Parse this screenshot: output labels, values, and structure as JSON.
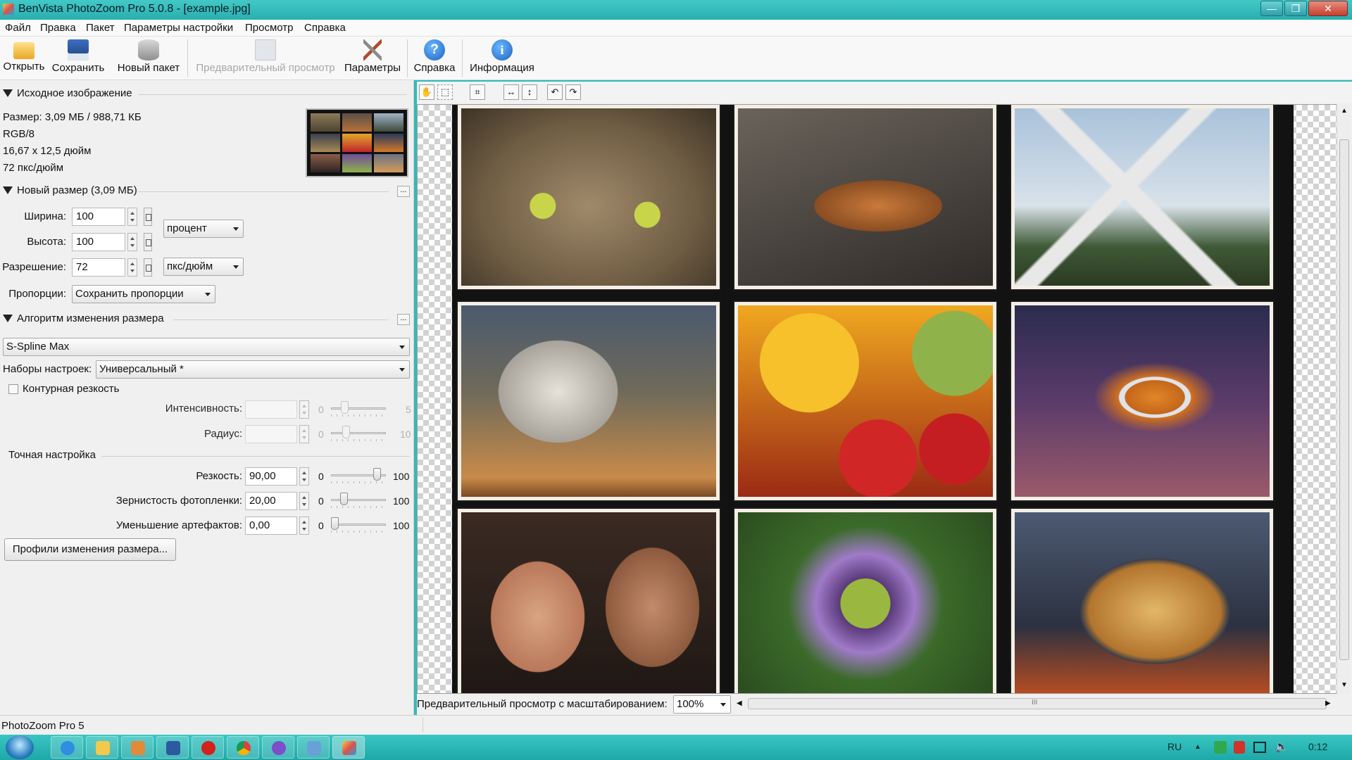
{
  "window": {
    "title": "BenVista PhotoZoom Pro 5.0.8 - [example.jpg]",
    "controls": [
      "—",
      "❐",
      "✕"
    ]
  },
  "menu": [
    "Файл",
    "Правка",
    "Пакет",
    "Параметры настройки",
    "Просмотр",
    "Справка"
  ],
  "toolbar": {
    "open": "Открыть",
    "save": "Сохранить",
    "new_batch": "Новый пакет",
    "preview": "Предварительный просмотр",
    "settings": "Параметры",
    "help": "Справка",
    "info": "Информация"
  },
  "source": {
    "header": "Исходное изображение",
    "size": "Размер: 3,09 МБ / 988,71 КБ",
    "mode": "RGB/8",
    "dimensions": "16,67 x 12,5 дюйм",
    "resolution": "72 пкс/дюйм"
  },
  "new_size": {
    "header": "Новый размер (3,09 МБ)",
    "more_button": "...",
    "width_label": "Ширина:",
    "width_value": "100",
    "height_label": "Высота:",
    "height_value": "100",
    "size_unit": "процент",
    "resolution_label": "Разрешение:",
    "resolution_value": "72",
    "resolution_unit": "пкс/дюйм",
    "proportions_label": "Пропорции:",
    "proportions_value": "Сохранить пропорции"
  },
  "algorithm": {
    "header": "Алгоритм изменения размера",
    "more_button": "...",
    "method": "S-Spline Max",
    "presets_label": "Наборы настроек:",
    "presets_value": "Универсальный *",
    "unsharp_label": "Контурная резкость",
    "intensity_label": "Интенсивность:",
    "intensity_min": "0",
    "intensity_max": "5",
    "radius_label": "Радиус:",
    "radius_min": "0",
    "radius_max": "10",
    "fine_header": "Точная настройка",
    "sharpness_label": "Резкость:",
    "sharpness_value": "90,00",
    "sharpness_min": "0",
    "sharpness_max": "100",
    "grain_label": "Зернистость фотопленки:",
    "grain_value": "20,00",
    "grain_min": "0",
    "grain_max": "100",
    "artifact_label": "Уменьшение артефактов:",
    "artifact_value": "0,00",
    "artifact_min": "0",
    "artifact_max": "100",
    "profiles_button": "Профили изменения размера..."
  },
  "levels": {
    "sharpness": 0.9,
    "grain": 0.2,
    "artifact": 0.0
  },
  "viewer": {
    "zoom_label": "Предварительный просмотр с масштабированием:",
    "zoom_value": "100%",
    "scroll_grip": "III",
    "photos": [
      "cat",
      "seashell",
      "windmill",
      "observatory",
      "fruit",
      "fish",
      "couple",
      "passion-flower",
      "roasted-potatoes"
    ]
  },
  "status": {
    "text": "PhotoZoom Pro 5"
  },
  "taskbar": {
    "lang": "RU",
    "time": "0:12",
    "apps": [
      "ie",
      "explorer",
      "media-player",
      "save",
      "opera",
      "chrome",
      "app-purple",
      "notes",
      "photozoom"
    ]
  },
  "colors": {
    "titlebar": "#2aaeb0",
    "taskbar": "#1ea8a8",
    "panel": "#f0f0f0",
    "accent": "#2c80d3"
  }
}
